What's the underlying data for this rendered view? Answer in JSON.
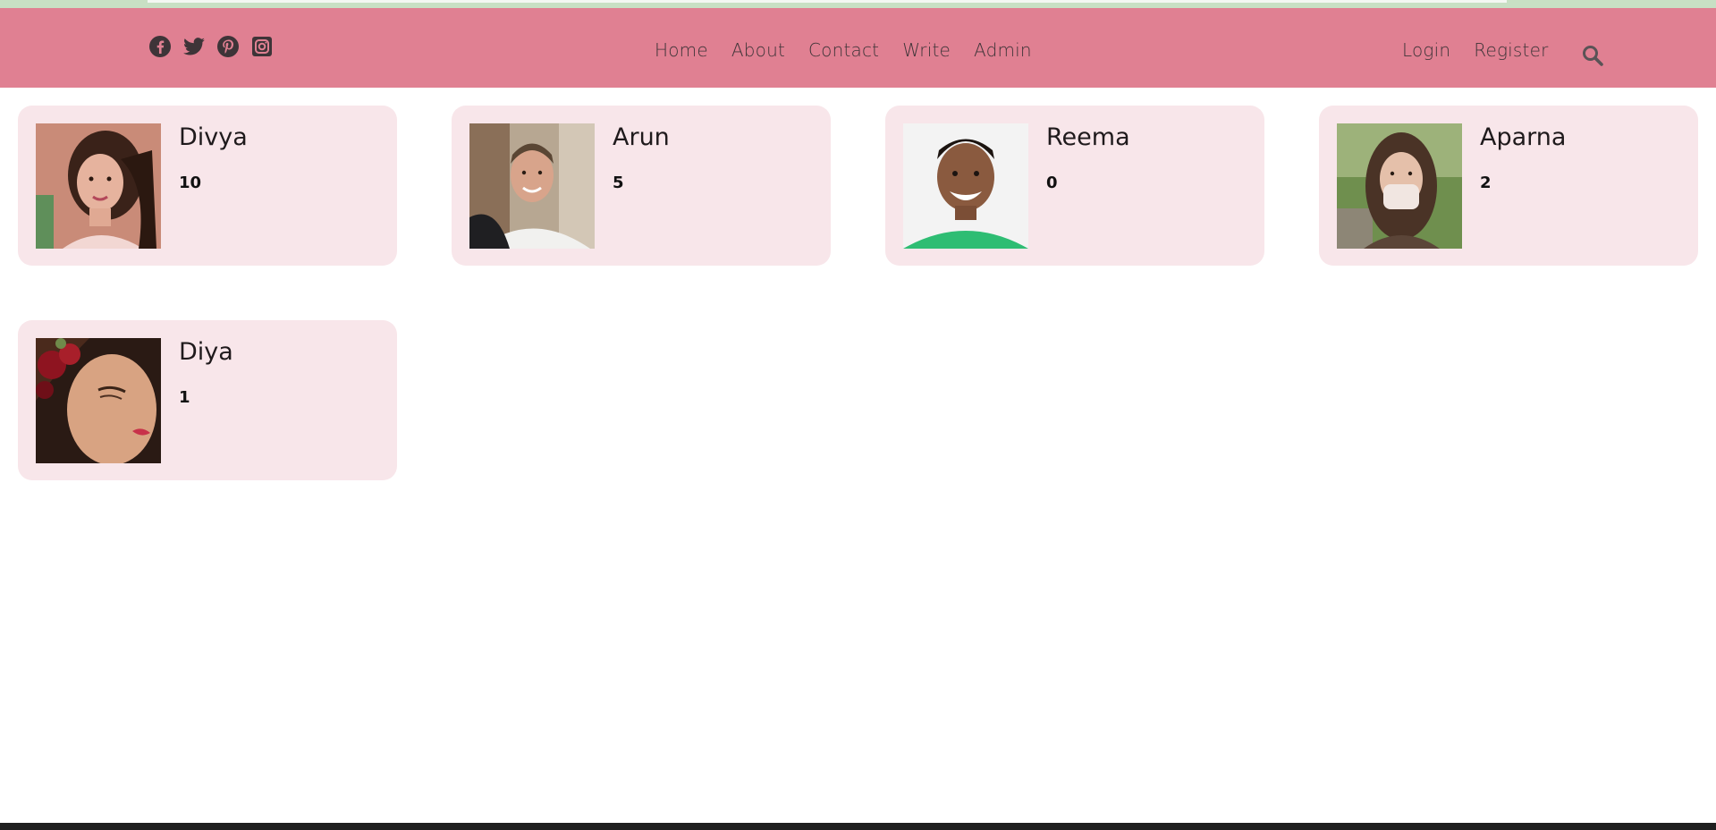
{
  "nav": {
    "social": [
      "facebook-icon",
      "twitter-icon",
      "pinterest-icon",
      "instagram-icon"
    ],
    "links": [
      "Home",
      "About",
      "Contact",
      "Write",
      "Admin"
    ],
    "auth": [
      "Login",
      "Register"
    ],
    "search_icon": "search-icon"
  },
  "colors": {
    "top_strip": "#c8e0c4",
    "navbar": "#e08092",
    "card_bg": "#f8e6ea",
    "nav_text": "#3e3438",
    "footer": "#1f1f1f"
  },
  "authors": [
    {
      "name": "Divya",
      "count": "10"
    },
    {
      "name": "Arun",
      "count": "5"
    },
    {
      "name": "Reema",
      "count": "0"
    },
    {
      "name": "Aparna",
      "count": "2"
    },
    {
      "name": "Diya",
      "count": "1"
    }
  ]
}
